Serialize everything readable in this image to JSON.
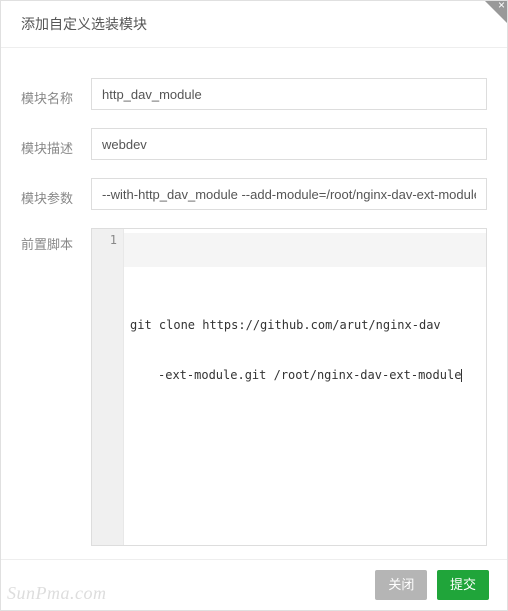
{
  "dialog": {
    "title": "添加自定义选装模块"
  },
  "form": {
    "name_label": "模块名称",
    "name_value": "http_dav_module",
    "desc_label": "模块描述",
    "desc_value": "webdev",
    "params_label": "模块参数",
    "params_value": "--with-http_dav_module --add-module=/root/nginx-dav-ext-module",
    "script_label": "前置脚本",
    "script_line_number": "1",
    "script_line1": "git clone https://github.com/arut/nginx-dav",
    "script_line2": "-ext-module.git /root/nginx-dav-ext-module"
  },
  "footer": {
    "cancel": "关闭",
    "submit": "提交"
  },
  "watermark": "SunPma.com"
}
